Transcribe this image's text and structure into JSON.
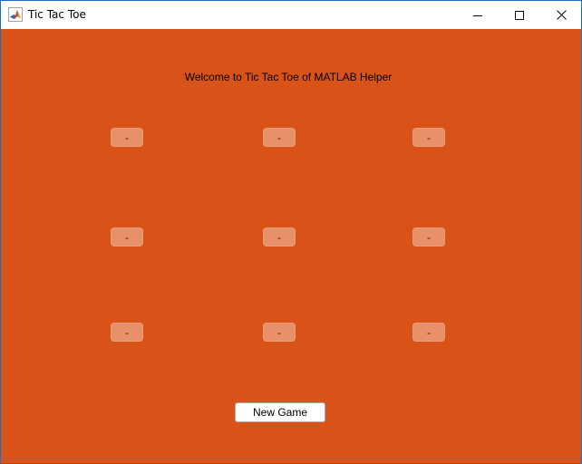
{
  "window": {
    "title": "Tic Tac Toe",
    "icon": "matlab-logo-icon"
  },
  "controls": {
    "minimize_icon": "minimize-icon",
    "maximize_icon": "maximize-icon",
    "close_icon": "close-icon"
  },
  "main": {
    "welcome": "Welcome to Tic Tac Toe of MATLAB Helper",
    "board": [
      [
        "-",
        "-",
        "-"
      ],
      [
        "-",
        "-",
        "-"
      ],
      [
        "-",
        "-",
        "-"
      ]
    ],
    "new_game_label": "New Game"
  },
  "colors": {
    "background": "#d95319",
    "cell": "#e8906a"
  }
}
